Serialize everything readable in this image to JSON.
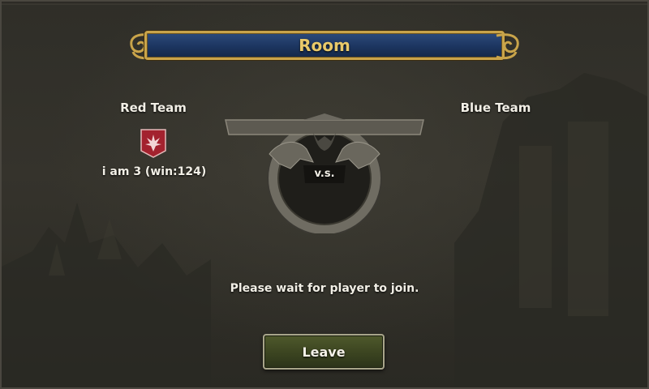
{
  "header": {
    "title": "Room"
  },
  "teams": {
    "red": {
      "label": "Red Team",
      "players": [
        {
          "name": "i am 3 (win:124)",
          "emblem": "red-shield-icon"
        }
      ]
    },
    "blue": {
      "label": "Blue Team",
      "players": []
    }
  },
  "versus": {
    "label": "v.s."
  },
  "status": {
    "message": "Please wait for player to join."
  },
  "actions": {
    "leave_label": "Leave"
  },
  "colors": {
    "title_text": "#e8c96a",
    "banner_fill": "#1c3560",
    "banner_border": "#c9a44a",
    "button_fill": "#3b4420",
    "team_red": "#a3222e"
  }
}
